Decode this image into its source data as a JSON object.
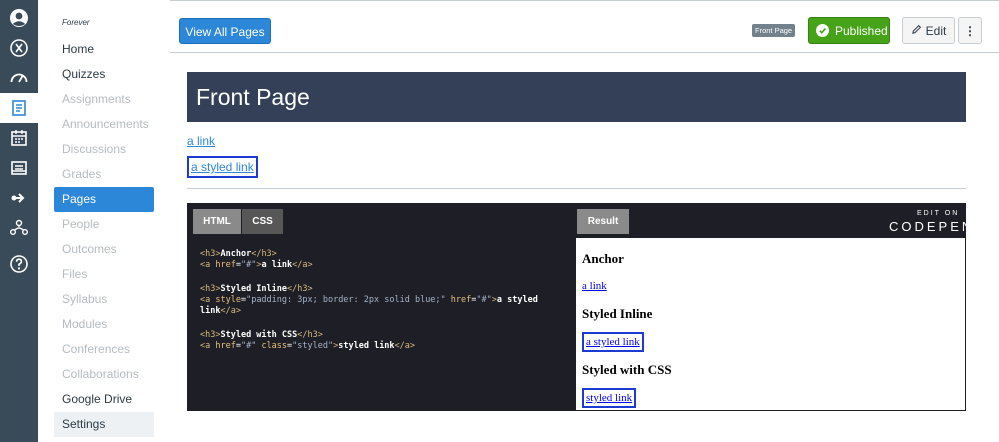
{
  "course": {
    "name": "Forever",
    "nav": [
      {
        "label": "Home",
        "state": "enabled"
      },
      {
        "label": "Quizzes",
        "state": "enabled"
      },
      {
        "label": "Assignments",
        "state": "disabled"
      },
      {
        "label": "Announcements",
        "state": "disabled"
      },
      {
        "label": "Discussions",
        "state": "disabled"
      },
      {
        "label": "Grades",
        "state": "disabled"
      },
      {
        "label": "Pages",
        "state": "active"
      },
      {
        "label": "People",
        "state": "disabled"
      },
      {
        "label": "Outcomes",
        "state": "disabled"
      },
      {
        "label": "Files",
        "state": "disabled"
      },
      {
        "label": "Syllabus",
        "state": "disabled"
      },
      {
        "label": "Modules",
        "state": "disabled"
      },
      {
        "label": "Conferences",
        "state": "disabled"
      },
      {
        "label": "Collaborations",
        "state": "disabled"
      },
      {
        "label": "Google Drive",
        "state": "enabled"
      },
      {
        "label": "Settings",
        "state": "hover"
      }
    ]
  },
  "global_nav": {
    "icons": [
      "avatar-icon",
      "shield-icon",
      "dashboard-icon",
      "courses-icon",
      "calendar-icon",
      "inbox-icon",
      "commons-icon",
      "network-icon",
      "help-icon"
    ]
  },
  "header": {
    "view_all_label": "View All Pages",
    "front_badge": "Front Page",
    "published_label": "Published",
    "edit_label": "Edit",
    "more_label": "⋮"
  },
  "page": {
    "title": "Front Page",
    "link1": "a link",
    "link2": "a styled link"
  },
  "codepen": {
    "tab_html": "HTML",
    "tab_css": "CSS",
    "tab_result": "Result",
    "edit_on": "EDIT ON",
    "brand": "CODEPEN",
    "result": {
      "h_anchor": "Anchor",
      "a_link": "a link",
      "h_inline": "Styled Inline",
      "a_styled": "a styled link",
      "h_css": "Styled with CSS",
      "a_css": "styled link"
    }
  },
  "colors": {
    "brand_blue": "#2d87d8",
    "published_green": "#46a318",
    "title_band": "#334058",
    "code_tag": "#dcdcaa",
    "code_attr": "#e8c07d",
    "code_string": "#a6b2c8"
  }
}
